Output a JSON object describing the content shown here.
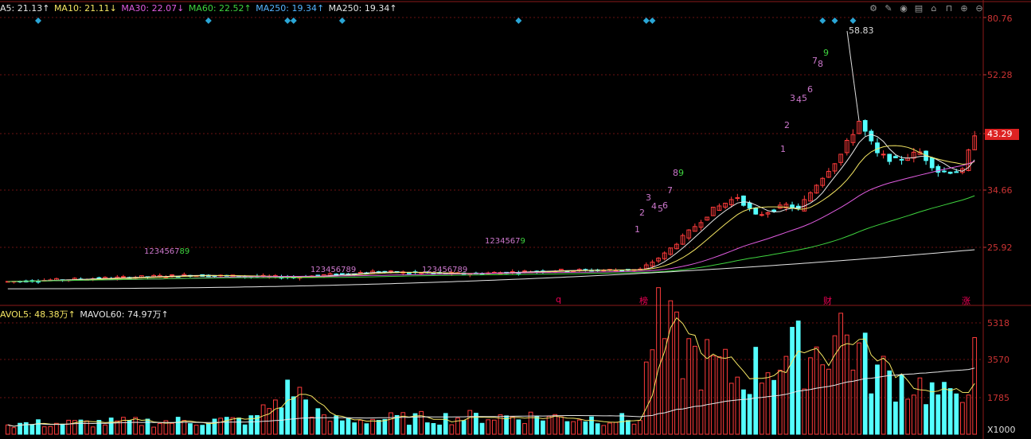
{
  "header": {
    "ma": [
      {
        "label": "A5: 21.13↑",
        "color": "#e6e6e6"
      },
      {
        "label": "MA10: 21.11↓",
        "color": "#f5e663"
      },
      {
        "label": "MA30: 22.07↓",
        "color": "#e05ce0"
      },
      {
        "label": "MA60: 22.52↑",
        "color": "#3fd43f"
      },
      {
        "label": "MA250: 19.34↑",
        "color": "#56b4ff"
      },
      {
        "label": "MA250: 19.34↑",
        "color": "#e6e6e6"
      }
    ]
  },
  "toolbar": [
    "gear-icon",
    "pen-icon",
    "eye-icon",
    "layers-icon",
    "home-icon",
    "lock-icon",
    "plus-icon",
    "minus-icon"
  ],
  "price_axis": [
    "80.76",
    "52.28",
    "43.29",
    "34.66",
    "25.92"
  ],
  "current_price": "43.29",
  "max_annotation": "58.83",
  "event_labels": [
    {
      "text": "q",
      "color": "#e05"
    },
    {
      "text": "榜",
      "color": "#e05"
    },
    {
      "text": "财",
      "color": "#e05"
    },
    {
      "text": "涨",
      "color": "#e05"
    }
  ],
  "sequences": [
    {
      "text": "1234567",
      "tail": "89",
      "color": "#e05ce0",
      "tail_color": "#3fd43f"
    },
    {
      "text": "123456789",
      "color": "#e05ce0"
    },
    {
      "text": "1234567",
      "tail": "9",
      "color": "#e05ce0",
      "tail_color": "#3fd43f"
    },
    {
      "text": "123456789",
      "color": "#e05ce0"
    },
    {
      "text": "1",
      "color": "#e05ce0"
    },
    {
      "text": "2",
      "color": "#e05ce0"
    },
    {
      "text": "3",
      "color": "#e05ce0"
    },
    {
      "text": "4",
      "color": "#e05ce0"
    },
    {
      "text": "5",
      "color": "#e05ce0"
    },
    {
      "text": "6",
      "color": "#e05ce0"
    },
    {
      "text": "7",
      "color": "#e05ce0"
    },
    {
      "text": "8",
      "color": "#e05ce0"
    },
    {
      "text": "9",
      "color": "#3fd43f"
    },
    {
      "text": "1",
      "color": "#e05ce0"
    },
    {
      "text": "2",
      "color": "#e05ce0"
    },
    {
      "text": "3",
      "color": "#e05ce0"
    },
    {
      "text": "4",
      "color": "#e05ce0"
    },
    {
      "text": "5",
      "color": "#e05ce0"
    },
    {
      "text": "6",
      "color": "#e05ce0"
    },
    {
      "text": "7",
      "color": "#e05ce0"
    },
    {
      "text": "8",
      "color": "#e05ce0"
    },
    {
      "text": "9",
      "color": "#3fd43f"
    }
  ],
  "volume_header": [
    {
      "label": "AVOL5: 48.38万↑",
      "color": "#f5e663"
    },
    {
      "label": "MAVOL60: 74.97万↑",
      "color": "#e6e6e6"
    }
  ],
  "volume_axis": [
    "5318",
    "3570",
    "1785"
  ],
  "volume_unit": "X1000",
  "chart_data": {
    "type": "candlestick",
    "price_ylim": [
      18,
      84
    ],
    "volume_ylim": [
      0,
      5800
    ],
    "candles_count": 160,
    "ma_lines": [
      "MA5",
      "MA10",
      "MA30",
      "MA60",
      "MA250"
    ],
    "signal_markers": [
      5,
      33,
      46,
      47,
      55,
      84,
      105,
      106,
      134,
      136,
      139
    ],
    "anchors": [
      {
        "i": 0,
        "c": 21.0
      },
      {
        "i": 10,
        "c": 21.5
      },
      {
        "i": 30,
        "c": 22.5
      },
      {
        "i": 47,
        "c": 22.0
      },
      {
        "i": 60,
        "c": 23.3
      },
      {
        "i": 75,
        "c": 22.8
      },
      {
        "i": 90,
        "c": 23.6
      },
      {
        "i": 104,
        "c": 23.8
      },
      {
        "i": 108,
        "c": 27.5
      },
      {
        "i": 116,
        "c": 38.0
      },
      {
        "i": 120,
        "c": 41.0
      },
      {
        "i": 123,
        "c": 36.5
      },
      {
        "i": 128,
        "c": 39.0
      },
      {
        "i": 130,
        "c": 38.0
      },
      {
        "i": 133,
        "c": 44.0
      },
      {
        "i": 137,
        "c": 51.0
      },
      {
        "i": 140,
        "c": 58.8
      },
      {
        "i": 143,
        "c": 51.0
      },
      {
        "i": 146,
        "c": 49.5
      },
      {
        "i": 150,
        "c": 51.5
      },
      {
        "i": 153,
        "c": 47.0
      },
      {
        "i": 157,
        "c": 47.0
      },
      {
        "i": 159,
        "c": 56.0
      }
    ],
    "vol_anchors": [
      {
        "i": 0,
        "v": 500
      },
      {
        "i": 40,
        "v": 700
      },
      {
        "i": 47,
        "v": 2300
      },
      {
        "i": 52,
        "v": 700
      },
      {
        "i": 85,
        "v": 900
      },
      {
        "i": 104,
        "v": 700
      },
      {
        "i": 106,
        "v": 5300
      },
      {
        "i": 113,
        "v": 3800
      },
      {
        "i": 120,
        "v": 2800
      },
      {
        "i": 126,
        "v": 3700
      },
      {
        "i": 133,
        "v": 4200
      },
      {
        "i": 137,
        "v": 5300
      },
      {
        "i": 142,
        "v": 3200
      },
      {
        "i": 150,
        "v": 2400
      },
      {
        "i": 155,
        "v": 1700
      },
      {
        "i": 159,
        "v": 3500
      }
    ]
  }
}
